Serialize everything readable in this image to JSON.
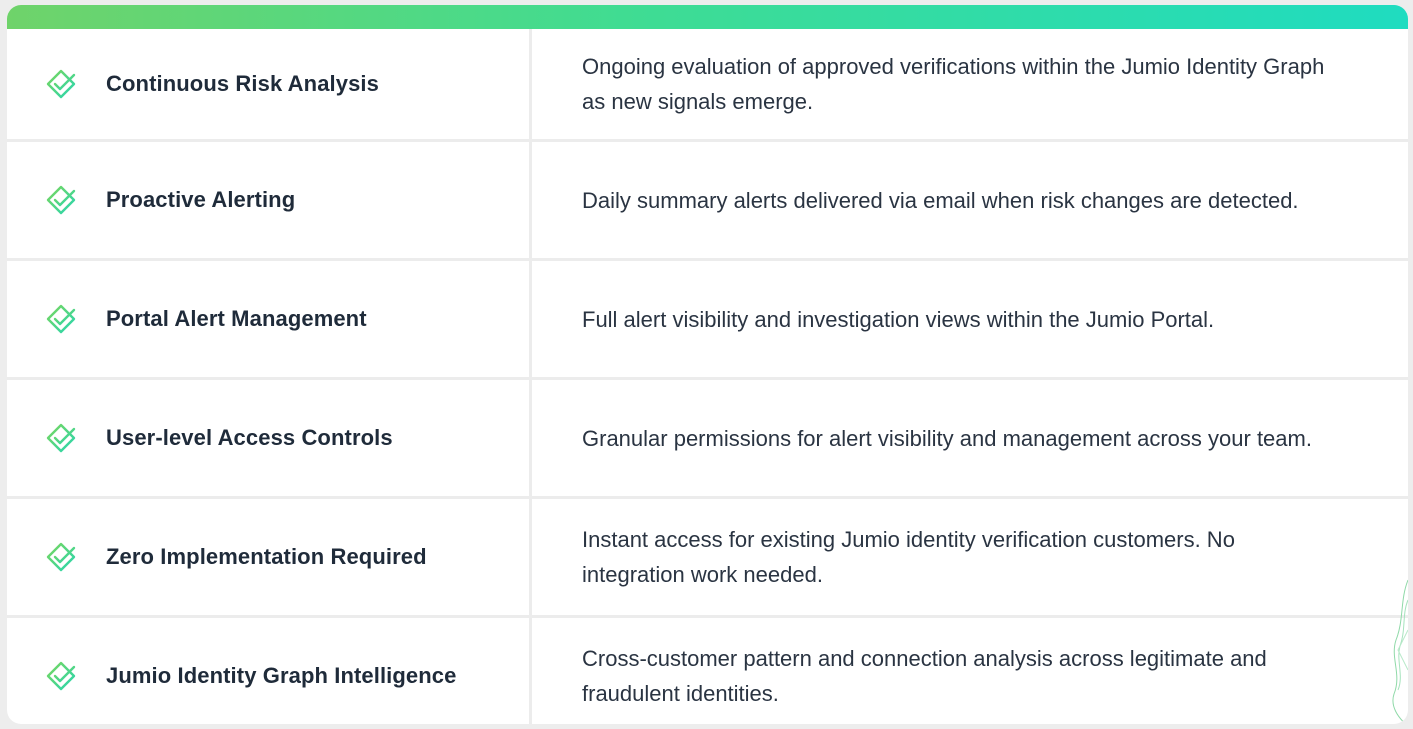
{
  "colors": {
    "accent_start": "#6fd36a",
    "accent_end": "#1fdcc0",
    "icon_stroke": "#4fd07a"
  },
  "features": [
    {
      "icon": "diamond-check-icon",
      "name": "Continuous Risk Analysis",
      "description": "Ongoing evaluation of approved verifications within the Jumio Identity Graph as new signals emerge."
    },
    {
      "icon": "diamond-check-icon",
      "name": "Proactive Alerting",
      "description": "Daily summary alerts delivered via email when risk changes are detected."
    },
    {
      "icon": "diamond-check-icon",
      "name": "Portal Alert Management",
      "description": "Full alert visibility and investigation views within the Jumio Portal."
    },
    {
      "icon": "diamond-check-icon",
      "name": "User-level Access Controls",
      "description": "Granular permissions for alert visibility and management across your team."
    },
    {
      "icon": "diamond-check-icon",
      "name": "Zero Implementation Required",
      "description": "Instant access for existing Jumio identity verification customers. No integration work needed."
    },
    {
      "icon": "diamond-check-icon",
      "name": "Jumio Identity Graph Intelligence",
      "description": "Cross-customer pattern and connection analysis across legitimate and fraudulent identities."
    }
  ]
}
